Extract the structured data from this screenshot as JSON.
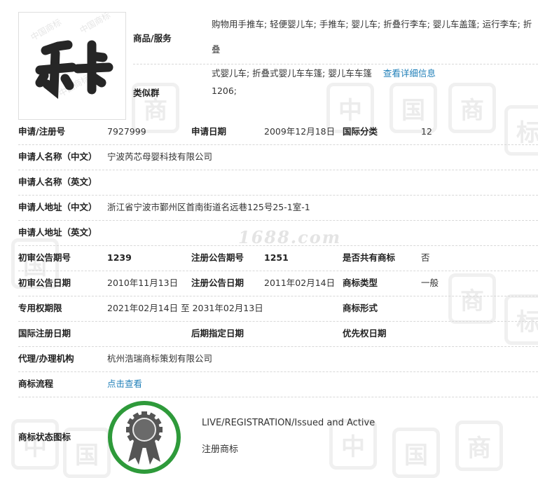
{
  "header": {
    "goods_label": "商品/服务",
    "goods_line1": "购物用手推车; 轻便婴儿车; 手推车; 婴儿车; 折叠行李车; 婴儿车盖篷; 运行李车; 折叠",
    "goods_line2": "式婴儿车; 折叠式婴儿车车篷; 婴儿车车篷",
    "goods_link": "查看详细信息",
    "similar_label": "类似群",
    "similar_value": "1206;"
  },
  "rows": {
    "reg_no_label": "申请/注册号",
    "reg_no": "7927999",
    "app_date_label": "申请日期",
    "app_date": "2009年12月18日",
    "intl_class_label": "国际分类",
    "intl_class": "12",
    "applicant_cn_label": "申请人名称（中文）",
    "applicant_cn": "宁波芮芯母婴科技有限公司",
    "applicant_en_label": "申请人名称（英文）",
    "addr_cn_label": "申请人地址（中文）",
    "addr_cn": "浙江省宁波市鄞州区首南街道名远巷125号25-1室-1",
    "addr_en_label": "申请人地址（英文）",
    "prelim_no_label": "初审公告期号",
    "prelim_no": "1239",
    "reg_pub_no_label": "注册公告期号",
    "reg_pub_no": "1251",
    "shared_label": "是否共有商标",
    "shared": "否",
    "prelim_date_label": "初审公告日期",
    "prelim_date": "2010年11月13日",
    "reg_pub_date_label": "注册公告日期",
    "reg_pub_date": "2011年02月14日",
    "tm_type_label": "商标类型",
    "tm_type": "一般",
    "exclusive_label": "专用权期限",
    "exclusive": "2021年02月14日 至 2031年02月13日",
    "tm_form_label": "商标形式",
    "intl_reg_date_label": "国际注册日期",
    "later_date_label": "后期指定日期",
    "priority_label": "优先权日期",
    "agent_label": "代理/办理机构",
    "agent": "杭州浩瑞商标策划有限公司",
    "flow_label": "商标流程",
    "flow_link": "点击查看",
    "status_icon_label": "商标状态图标"
  },
  "status": {
    "english": "LIVE/REGISTRATION/Issued and Active",
    "chinese": "注册商标"
  },
  "watermark": {
    "site": "1688.com",
    "glyph_a": "中",
    "glyph_b": "国",
    "glyph_c": "商",
    "glyph_d": "标"
  },
  "logo": {
    "text": "乐卡"
  },
  "colors": {
    "link": "#1f7fb8",
    "badge_ring": "#2e9a3a",
    "badge_seal": "#555555"
  }
}
